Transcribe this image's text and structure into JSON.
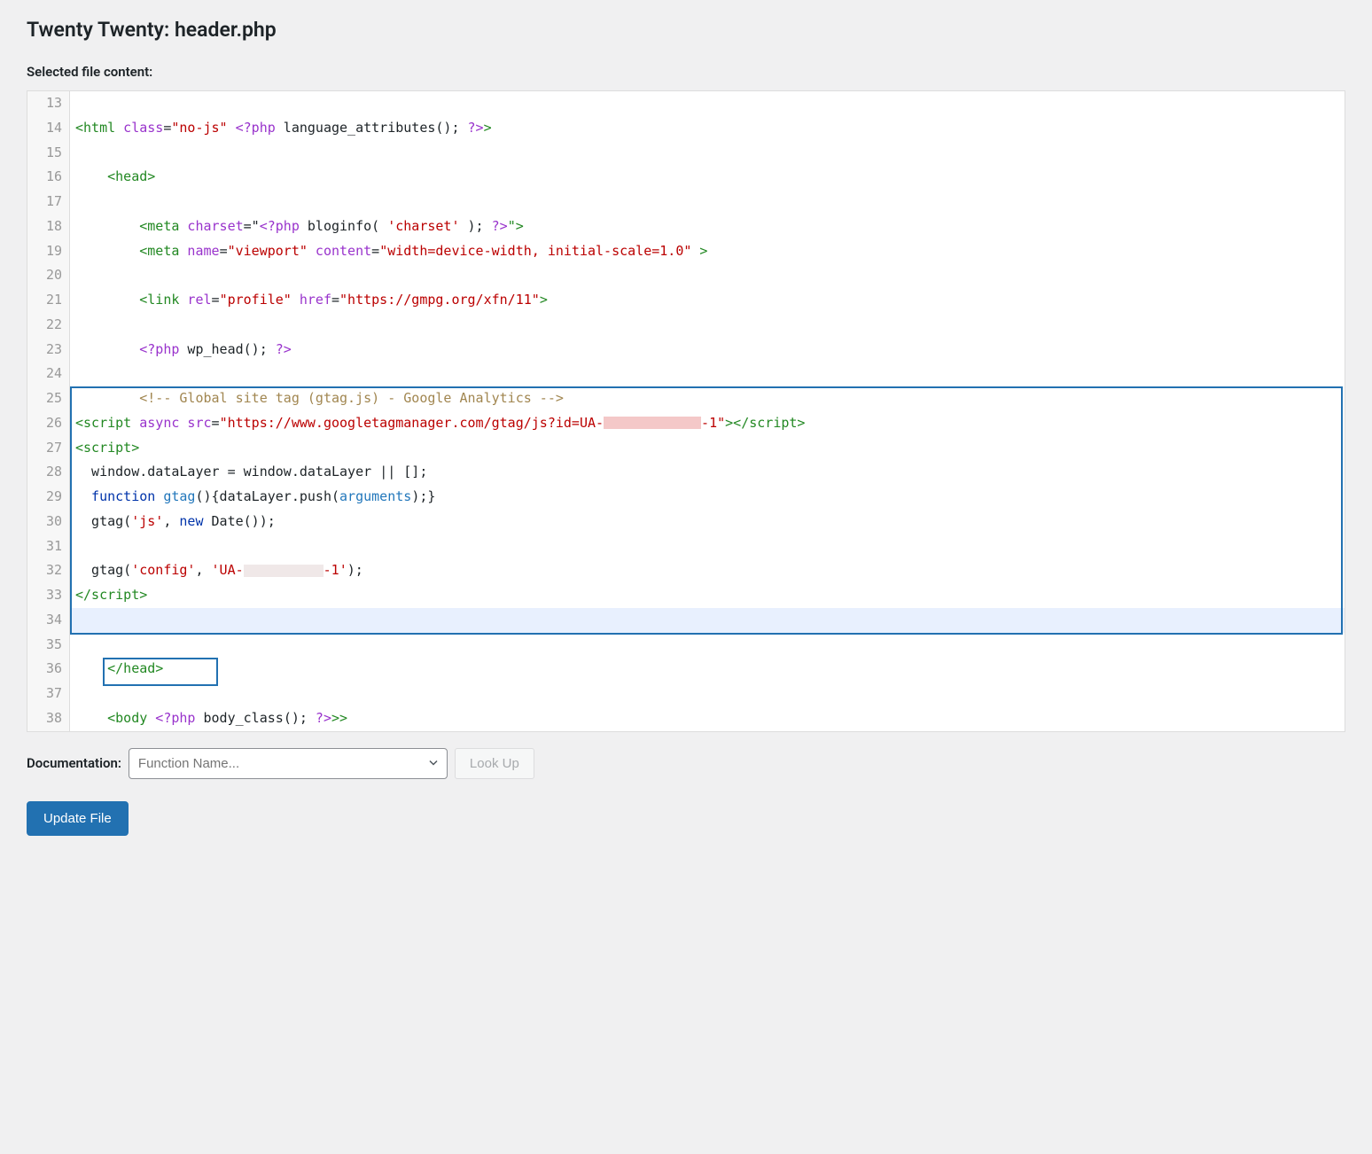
{
  "page_title": "Twenty Twenty: header.php",
  "section_label": "Selected file content:",
  "lines": {
    "l13": "13",
    "l14": "14",
    "l15": "15",
    "l16": "16",
    "l17": "17",
    "l18": "18",
    "l19": "19",
    "l20": "20",
    "l21": "21",
    "l22": "22",
    "l23": "23",
    "l24": "24",
    "l25": "25",
    "l26": "26",
    "l27": "27",
    "l28": "28",
    "l29": "29",
    "l30": "30",
    "l31": "31",
    "l32": "32",
    "l33": "33",
    "l34": "34",
    "l35": "35",
    "l36": "36",
    "l37": "37",
    "l38": "38"
  },
  "code": {
    "l14_html": "<html",
    "l14_class": " class",
    "l14_eq": "=",
    "l14_nojs": "\"no-js\"",
    "l14_phpopen": " <?php",
    "l14_langattr": " language_attributes",
    "l14_parens": "();",
    "l14_phpclose": " ?>",
    "l14_gt": ">",
    "l16_head": "    <head>",
    "l18_meta": "        <meta",
    "l18_charset": " charset",
    "l18_eq": "=\"",
    "l18_phpopen": "<?php",
    "l18_bloginfo": " bloginfo",
    "l18_p1": "( ",
    "l18_charsetstr": "'charset'",
    "l18_p2": " );",
    "l18_phpclose": " ?>",
    "l18_close": "\">",
    "l19_meta": "        <meta",
    "l19_name": " name",
    "l19_eq1": "=",
    "l19_viewport": "\"viewport\"",
    "l19_content": " content",
    "l19_eq2": "=",
    "l19_contentval": "\"width=device-width, initial-scale=1.0\"",
    "l19_gt": " >",
    "l21_link": "        <link",
    "l21_rel": " rel",
    "l21_eq1": "=",
    "l21_profile": "\"profile\"",
    "l21_href": " href",
    "l21_eq2": "=",
    "l21_url": "\"https://gmpg.org/xfn/11\"",
    "l21_gt": ">",
    "l23_phpopen": "        <?php",
    "l23_wphead": " wp_head",
    "l23_parens": "();",
    "l23_phpclose": " ?>",
    "l25_comment": "        <!-- Global site tag (gtag.js) - Google Analytics -->",
    "l26_script": "<script",
    "l26_async": " async",
    "l26_src": " src",
    "l26_eq": "=",
    "l26_url1": "\"https://www.googletagmanager.com/gtag/js?id=UA-",
    "l26_url2": "-1\"",
    "l26_gt": ">",
    "l26_close": "</script>",
    "l27": "<script>",
    "l28_1": "  window.dataLayer ",
    "l28_2": "=",
    "l28_3": " window.dataLayer ",
    "l28_4": "||",
    "l28_5": " [];",
    "l29_fn": "  function",
    "l29_gtag": " gtag",
    "l29_p1": "(){dataLayer.push(",
    "l29_args": "arguments",
    "l29_p2": ");}",
    "l30_1": "  gtag(",
    "l30_js": "'js'",
    "l30_2": ", ",
    "l30_new": "new",
    "l30_3": " Date());",
    "l32_1": "  gtag(",
    "l32_config": "'config'",
    "l32_2": ", ",
    "l32_ua": "'UA-",
    "l32_ua2": "-1'",
    "l32_3": ");",
    "l33": "</script>",
    "l36_head": "    </head>",
    "l38_body": "    <body",
    "l38_phpopen": " <?php",
    "l38_bodyclass": " body_class",
    "l38_parens": "();",
    "l38_phpclose": " ?>",
    "l38_gt": ">>"
  },
  "doc": {
    "label": "Documentation:",
    "placeholder": "Function Name...",
    "lookup": "Look Up"
  },
  "update_button": "Update File"
}
